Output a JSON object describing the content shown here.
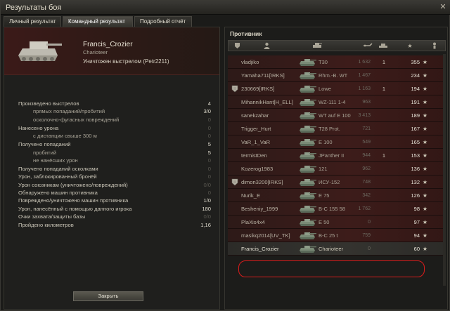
{
  "window": {
    "title": "Результаты боя",
    "close_glyph": "✕"
  },
  "tabs": [
    {
      "label": "Личный результат"
    },
    {
      "label": "Командный результат"
    },
    {
      "label": "Подробный отчёт"
    }
  ],
  "hero": {
    "player_name": "Francis_Crozier",
    "tank_name": "Charioteer",
    "destroyed_text": "Уничтожен выстрелом (Petr2211)"
  },
  "stats": [
    {
      "label": "Произведено выстрелов",
      "value": "4",
      "indent": false,
      "dim": false
    },
    {
      "label": "прямых попаданий/пробитий",
      "value": "3/0",
      "indent": true,
      "dim": false
    },
    {
      "label": "осколочно-фугасных повреждений",
      "value": "0",
      "indent": true,
      "dim": true
    },
    {
      "label": "Нанесено урона",
      "value": "0",
      "indent": false,
      "dim": true
    },
    {
      "label": "с дистанции свыше 300 м",
      "value": "0",
      "indent": true,
      "dim": true
    },
    {
      "label": "Получено попаданий",
      "value": "5",
      "indent": false,
      "dim": false
    },
    {
      "label": "пробитий",
      "value": "5",
      "indent": true,
      "dim": false
    },
    {
      "label": "не нанёсших урон",
      "value": "0",
      "indent": true,
      "dim": true
    },
    {
      "label": "Получено попаданий осколками",
      "value": "0",
      "indent": false,
      "dim": true
    },
    {
      "label": "Урон, заблокированный бронёй",
      "value": "0",
      "indent": false,
      "dim": true
    },
    {
      "label": "Урон союзникам (уничтожено/повреждений)",
      "value": "0/0",
      "indent": false,
      "dim": true
    },
    {
      "label": "Обнаружено машин противника",
      "value": "0",
      "indent": false,
      "dim": true
    },
    {
      "label": "Повреждено/уничтожено машин противника",
      "value": "1/0",
      "indent": false,
      "dim": false
    },
    {
      "label": "Урон, нанесённый с помощью данного игрока",
      "value": "180",
      "indent": false,
      "dim": false
    },
    {
      "label": "Очки захвата/защиты базы",
      "value": "0/0",
      "indent": false,
      "dim": true
    },
    {
      "label": "Пройдено километров",
      "value": "1,16",
      "indent": false,
      "dim": false
    }
  ],
  "buttons": {
    "close_label": "Закрыть"
  },
  "enemy_panel": {
    "title": "Противник",
    "header_icons": [
      "medal-icon",
      "player-icon",
      "tank-icon",
      "damage-icon",
      "frags-icon",
      "xp-star-icon",
      "rank-icon"
    ],
    "rows": [
      {
        "player": "vladjiko",
        "tank": "T30",
        "damage": "1 632",
        "kills": "1",
        "xp": "355",
        "medal": false,
        "self": false
      },
      {
        "player": "Yamaha711[IRKS]",
        "tank": "Rhm.-B. WT",
        "damage": "1 467",
        "kills": "",
        "xp": "234",
        "medal": false,
        "self": false
      },
      {
        "player": "230669[IRKS]",
        "tank": "Lowe",
        "damage": "1 163",
        "kills": "1",
        "xp": "194",
        "medal": true,
        "self": false
      },
      {
        "player": "MihannikHant[H_ELL]",
        "tank": "WZ-111 1-4",
        "damage": "963",
        "kills": "",
        "xp": "191",
        "medal": false,
        "self": false
      },
      {
        "player": "sanekzahar",
        "tank": "WT auf E 100",
        "damage": "3 413",
        "kills": "",
        "xp": "189",
        "medal": false,
        "self": false
      },
      {
        "player": "Trigger_Hurt",
        "tank": "T28 Prot.",
        "damage": "721",
        "kills": "",
        "xp": "167",
        "medal": false,
        "self": false
      },
      {
        "player": "VaR_1_VaR",
        "tank": "E 100",
        "damage": "549",
        "kills": "",
        "xp": "165",
        "medal": false,
        "self": false
      },
      {
        "player": "termistDen",
        "tank": "JPanther II",
        "damage": "944",
        "kills": "1",
        "xp": "153",
        "medal": false,
        "self": false
      },
      {
        "player": "Kozerog1983",
        "tank": "121",
        "damage": "962",
        "kills": "",
        "xp": "136",
        "medal": false,
        "self": false
      },
      {
        "player": "dimon3200[IRKS]",
        "tank": "ИСУ-152",
        "damage": "748",
        "kills": "",
        "xp": "132",
        "medal": true,
        "self": false
      },
      {
        "player": "Nurik_E",
        "tank": "E 75",
        "damage": "342",
        "kills": "",
        "xp": "126",
        "medal": false,
        "self": false
      },
      {
        "player": "Besheniy_1999",
        "tank": "B-C 155 58",
        "damage": "1 762",
        "kills": "",
        "xp": "98",
        "medal": false,
        "self": false
      },
      {
        "player": "PlaXis4x4",
        "tank": "E 50",
        "damage": "0",
        "kills": "",
        "xp": "97",
        "medal": false,
        "self": false
      },
      {
        "player": "masikq2014[UV_TK]",
        "tank": "B-C 25 t",
        "damage": "759",
        "kills": "",
        "xp": "94",
        "medal": false,
        "self": false
      },
      {
        "player": "Francis_Crozier",
        "tank": "Charioteer",
        "damage": "0",
        "kills": "",
        "xp": "60",
        "medal": false,
        "self": true
      }
    ]
  },
  "colors": {
    "highlight": "#d91c1c",
    "enemy_row": "#3d1c1a",
    "self_row": "#34332f"
  }
}
